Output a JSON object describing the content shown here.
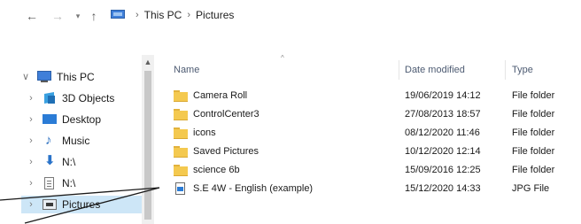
{
  "nav": {
    "back_icon": "←",
    "forward_icon": "→",
    "recent_icon": "▾",
    "up_icon": "↑",
    "breadcrumb": [
      "This PC",
      "Pictures"
    ],
    "separator": "›"
  },
  "sidebar": {
    "scroll_up_icon": "▲",
    "items": [
      {
        "label": "This PC",
        "chevron": "∨",
        "icon": "computer-icon"
      },
      {
        "label": "3D Objects",
        "chevron": "›",
        "icon": "3d-objects-icon"
      },
      {
        "label": "Desktop",
        "chevron": "›",
        "icon": "desktop-icon"
      },
      {
        "label": "Music",
        "chevron": "›",
        "icon": "music-icon"
      },
      {
        "label": "N:\\",
        "chevron": "›",
        "icon": "download-drive-icon"
      },
      {
        "label": "N:\\",
        "chevron": "›",
        "icon": "drive-icon"
      },
      {
        "label": "Pictures",
        "chevron": "›",
        "icon": "pictures-icon"
      }
    ]
  },
  "columns": {
    "name": "Name",
    "date": "Date modified",
    "type": "Type",
    "sort_indicator": "^"
  },
  "files": [
    {
      "name": "Camera Roll",
      "date": "19/06/2019 14:12",
      "type": "File folder",
      "icon": "folder-icon"
    },
    {
      "name": "ControlCenter3",
      "date": "27/08/2013 18:57",
      "type": "File folder",
      "icon": "folder-icon"
    },
    {
      "name": "icons",
      "date": "08/12/2020 11:46",
      "type": "File folder",
      "icon": "folder-icon"
    },
    {
      "name": "Saved Pictures",
      "date": "10/12/2020 12:14",
      "type": "File folder",
      "icon": "folder-icon"
    },
    {
      "name": "science 6b",
      "date": "15/09/2016 12:25",
      "type": "File folder",
      "icon": "folder-icon"
    },
    {
      "name": "S.E 4W - English (example)",
      "date": "15/12/2020 14:33",
      "type": "JPG File",
      "icon": "image-file-icon"
    }
  ],
  "colors": {
    "selection": "#cde6f7",
    "folder": "#f4c94f",
    "accent_blue": "#2b7cd6"
  }
}
